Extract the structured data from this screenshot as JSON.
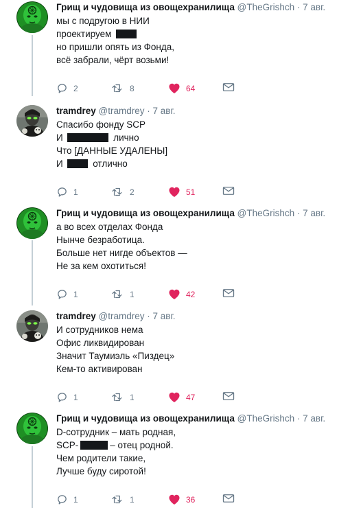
{
  "colors": {
    "text": "#14171a",
    "muted": "#657786",
    "like": "#e0245e",
    "line": "#c4cfd6"
  },
  "tweets": [
    {
      "name": "Грищ и чудовища из овощехранилища",
      "handle": "@TheGrishch",
      "time": "7 авг.",
      "avatar": "green-head",
      "lines": [
        [
          "мы с подругою в НИИ"
        ],
        [
          "проектируем ",
          {
            "redact": 3
          }
        ],
        [
          "но пришли опять из Фонда,"
        ],
        [
          "всё забрали, чёрт возьми!"
        ]
      ],
      "replies": "2",
      "retweets": "8",
      "likes": "64"
    },
    {
      "name": "tramdrey",
      "handle": "@tramdrey",
      "time": "7 авг.",
      "avatar": "dark-person",
      "lines": [
        [
          "Спасибо фонду SCP"
        ],
        [
          "И ",
          {
            "redact": 6
          },
          " лично"
        ],
        [
          "Что [ДАННЫЕ УДАЛЕНЫ]"
        ],
        [
          "И ",
          {
            "redact": 3
          },
          " отлично"
        ]
      ],
      "replies": "1",
      "retweets": "2",
      "likes": "51"
    },
    {
      "name": "Грищ и чудовища из овощехранилища",
      "handle": "@TheGrishch",
      "time": "7 авг.",
      "avatar": "green-head",
      "lines": [
        [
          "а во всех отделах Фонда"
        ],
        [
          "Нынче безработица."
        ],
        [
          "Больше нет нигде объектов —"
        ],
        [
          "Не за кем охотиться!"
        ]
      ],
      "replies": "1",
      "retweets": "1",
      "likes": "42"
    },
    {
      "name": "tramdrey",
      "handle": "@tramdrey",
      "time": "7 авг.",
      "avatar": "dark-person",
      "lines": [
        [
          "И сотрудников нема"
        ],
        [
          "Офис ликвидирован"
        ],
        [
          "Значит Таумиэль «Пиздец»"
        ],
        [
          "Кем-то активирован"
        ]
      ],
      "replies": "1",
      "retweets": "1",
      "likes": "47"
    },
    {
      "name": "Грищ и чудовища из овощехранилища",
      "handle": "@TheGrishch",
      "time": "7 авг.",
      "avatar": "green-head",
      "lines": [
        [
          "D-сотрудник – мать родная,"
        ],
        [
          "SCP-",
          {
            "redact": 4
          },
          "– отец родной."
        ],
        [
          "Чем родители такие,"
        ],
        [
          "Лучше буду сиротой!"
        ]
      ],
      "replies": "1",
      "retweets": "1",
      "likes": "36"
    }
  ]
}
